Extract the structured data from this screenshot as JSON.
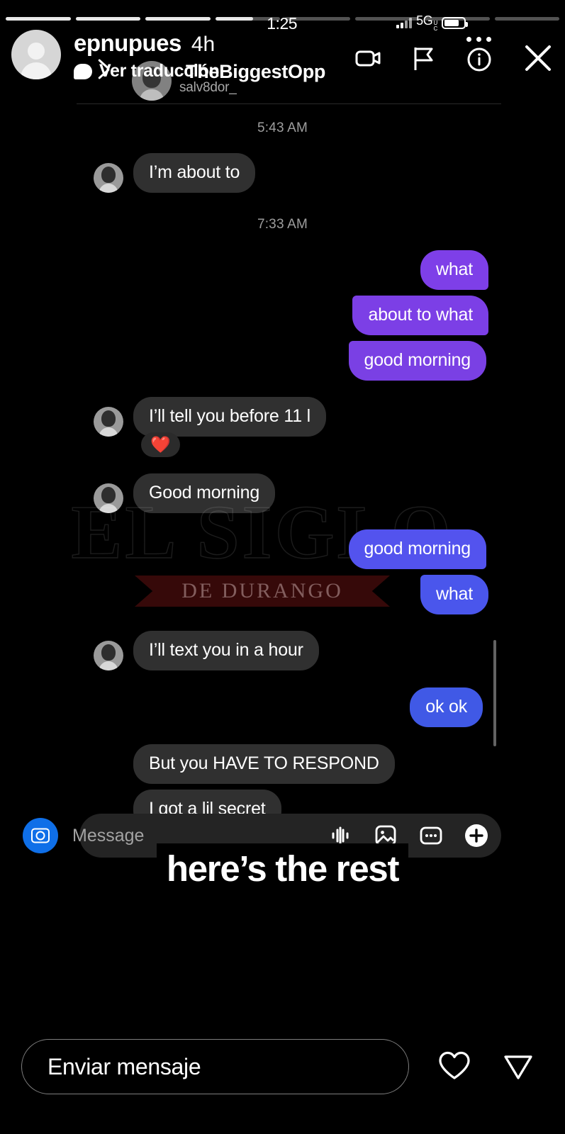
{
  "status_bar": {
    "time": "1:25",
    "network": "5G",
    "network_sup_top": "U",
    "network_sup_bottom": "C",
    "battery_level": 76,
    "signal_bars": 4
  },
  "story_progress": {
    "total_segments": 8,
    "completed_segments": 3,
    "active_segment_percent": 58
  },
  "story_header": {
    "username": "epnupues",
    "age": "4h",
    "translate_label": "Ver traducción",
    "avatar_icon": "default-person-avatar",
    "actions": [
      {
        "name": "video-camera-icon",
        "label": "Video"
      },
      {
        "name": "flag-icon",
        "label": "Report"
      },
      {
        "name": "info-circle-icon",
        "label": "Info"
      },
      {
        "name": "close-icon",
        "label": "Close"
      }
    ],
    "overflow_menu": "more-options-icon"
  },
  "dm_screenshot": {
    "back_icon": "back-chevron-icon",
    "peer_name": "TheBiggestOpp",
    "peer_handle": "salv8dor_",
    "timestamps": [
      "5:43 AM",
      "7:33 AM"
    ],
    "messages": [
      {
        "id": "m1",
        "side": "in",
        "text": "I’m about to",
        "bubble": "#303030",
        "avatar": true
      },
      {
        "id": "m2",
        "side": "out",
        "text": "what",
        "bubble": "#7e3fe8"
      },
      {
        "id": "m3",
        "side": "out",
        "text": "about to what",
        "bubble": "#7c3fe6"
      },
      {
        "id": "m4",
        "side": "out",
        "text": "good morning",
        "bubble": "#7a40e4"
      },
      {
        "id": "m5",
        "side": "in",
        "text": "I’ll tell you before 11 l",
        "bubble": "#303030",
        "avatar": true
      },
      {
        "id": "m6",
        "side": "in",
        "text": "❤️",
        "reaction": true,
        "bubble": "#2b2b2b"
      },
      {
        "id": "m7",
        "side": "in",
        "text": "Good morning",
        "bubble": "#303030",
        "avatar": true
      },
      {
        "id": "m8",
        "side": "out",
        "text": "good morning",
        "bubble": "#5353ee"
      },
      {
        "id": "m9",
        "side": "out",
        "text": "what",
        "bubble": "#4a56ec"
      },
      {
        "id": "m10",
        "side": "in",
        "text": "I’ll text you in a hour",
        "bubble": "#303030",
        "avatar": true
      },
      {
        "id": "m11",
        "side": "out",
        "text": "ok ok",
        "bubble": "#4059e6"
      },
      {
        "id": "m12",
        "side": "in",
        "text": "But you HAVE TO RESPOND",
        "bubble": "#303030"
      },
      {
        "id": "m13",
        "side": "in",
        "text": "I got a lil secret",
        "bubble": "#303030"
      }
    ],
    "composer": {
      "camera_icon": "camera-icon",
      "placeholder": "Message",
      "icons": [
        {
          "name": "voice-clip-icon"
        },
        {
          "name": "gallery-image-icon"
        },
        {
          "name": "sticker-icon"
        },
        {
          "name": "add-plus-icon"
        }
      ]
    }
  },
  "watermark": {
    "main": "EL SIGLO",
    "sub": "DE DURANGO"
  },
  "caption": {
    "text": "here’s the rest"
  },
  "reply_bar": {
    "placeholder": "Enviar mensaje",
    "like_icon": "heart-icon",
    "send_icon": "send-paper-plane-icon"
  },
  "colors": {
    "background": "#000000",
    "incoming_bubble": "#303030",
    "purple_bubble": "#7c3fe6",
    "blue_bubble": "#4a56ec",
    "accent_camera_blue": "#0f6fe8",
    "muted_text": "#9e9e9e"
  }
}
